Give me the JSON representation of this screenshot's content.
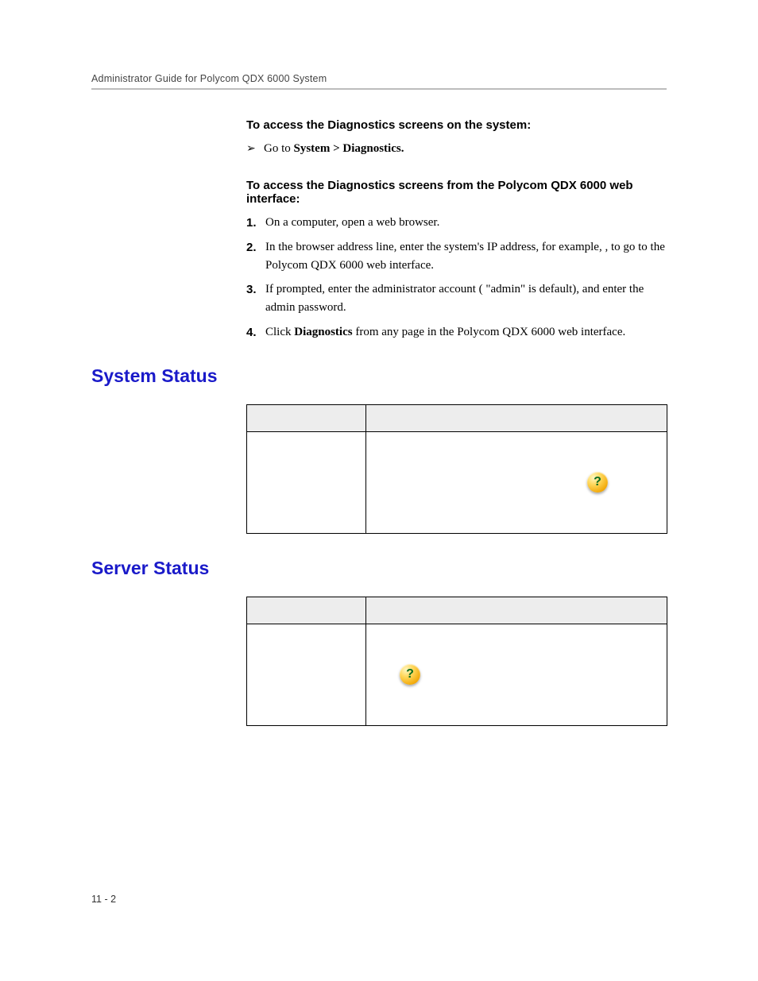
{
  "header": {
    "running_head": "Administrator Guide for Polycom QDX 6000 System"
  },
  "proc1": {
    "title": "To access the Diagnostics screens on the system:",
    "arrow_glyph": "➢",
    "step_prefix": "Go to ",
    "step_bold": "System > Diagnostics."
  },
  "proc2": {
    "title": "To access the Diagnostics screens from the Polycom QDX 6000 web interface:",
    "n1": "1.",
    "s1": "On a computer, open a web browser.",
    "n2": "2.",
    "s2a": "In the browser address line, enter the system's IP address, for example, ",
    "s2b": ", to go to the Polycom QDX 6000 web interface.",
    "n3": "3.",
    "s3": "If prompted, enter the administrator account ( \"admin\" is  default), and enter the admin password.",
    "n4": "4.",
    "s4_pre": "Click ",
    "s4_bold": "Diagnostics",
    "s4_post": " from any page in the Polycom QDX 6000 web interface."
  },
  "sections": {
    "system_status": {
      "title": "System Status"
    },
    "server_status": {
      "title": "Server Status"
    }
  },
  "icons": {
    "help_glyph": "?"
  },
  "footer": {
    "page_num": "11 - 2"
  }
}
